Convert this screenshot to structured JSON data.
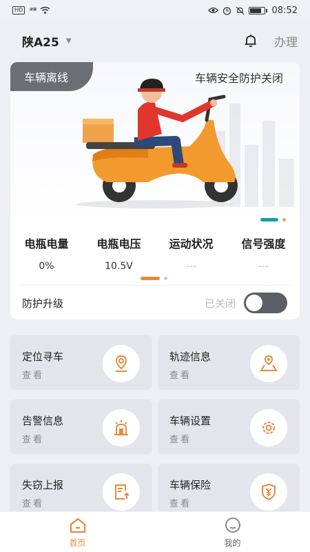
{
  "status_bar": {
    "time": "08:52",
    "hd": "HD",
    "signal": "⁴⁶ᴵᴵᴵ"
  },
  "header": {
    "plate": "陕A25",
    "caret": "▼",
    "action": "办理"
  },
  "banner": {
    "offline_tag": "车辆离线",
    "protect_status": "车辆安全防护关闭"
  },
  "stats": [
    {
      "label": "电瓶电量",
      "value": "0%"
    },
    {
      "label": "电瓶电压",
      "value": "10.5V"
    },
    {
      "label": "运动状况",
      "value": "---"
    },
    {
      "label": "信号强度",
      "value": "---"
    }
  ],
  "upgrade": {
    "label": "防护升级",
    "status": "已关闭",
    "enabled": false
  },
  "tiles": [
    {
      "title": "定位寻车",
      "sub": "查看",
      "icon": "location-pin-icon"
    },
    {
      "title": "轨迹信息",
      "sub": "查看",
      "icon": "map-route-icon"
    },
    {
      "title": "告警信息",
      "sub": "查看",
      "icon": "alarm-light-icon"
    },
    {
      "title": "车辆设置",
      "sub": "查看",
      "icon": "gear-icon"
    },
    {
      "title": "失窃上报",
      "sub": "查看",
      "icon": "report-upload-icon"
    },
    {
      "title": "车辆保险",
      "sub": "查看",
      "icon": "insurance-shield-icon"
    }
  ],
  "tabs": [
    {
      "label": "首页",
      "active": true
    },
    {
      "label": "我的",
      "active": false
    }
  ],
  "colors": {
    "accent": "#e8893a",
    "teal": "#17a0a0",
    "tag_gray": "#6b6e74"
  }
}
